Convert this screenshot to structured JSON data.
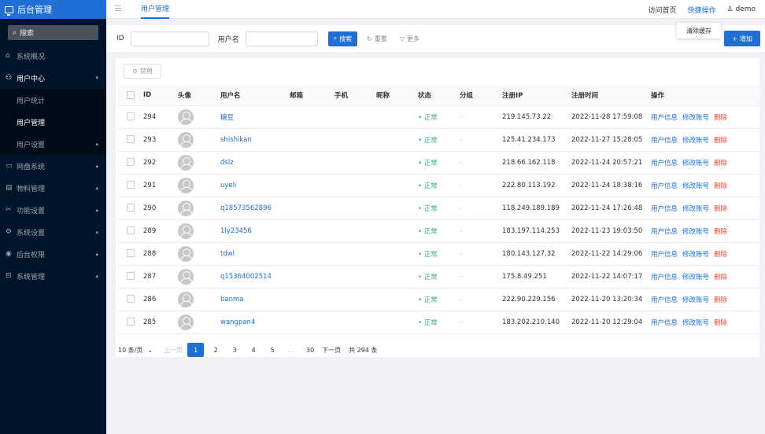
{
  "app": {
    "title": "后台管理"
  },
  "sidebar": {
    "search_label": "搜索",
    "items": [
      {
        "icon": "home-icon",
        "glyph": "⌂",
        "label": "系统概况"
      },
      {
        "icon": "user-group-icon",
        "glyph": "⚇",
        "label": "用户中心"
      },
      {
        "icon": "cloud-disk-icon",
        "glyph": "▭",
        "label": "网盘系统"
      },
      {
        "icon": "materials-icon",
        "glyph": "▤",
        "label": "物料管理"
      },
      {
        "icon": "function-settings-icon",
        "glyph": "✂",
        "label": "功能设置"
      },
      {
        "icon": "system-settings-icon",
        "glyph": "⚙",
        "label": "系统设置"
      },
      {
        "icon": "permissions-icon",
        "glyph": "◉",
        "label": "后台权限"
      },
      {
        "icon": "system-manage-icon",
        "glyph": "⊟",
        "label": "系统管理"
      }
    ],
    "submenu": [
      {
        "label": "用户统计"
      },
      {
        "label": "用户管理"
      },
      {
        "label": "用户设置"
      }
    ]
  },
  "topbar": {
    "tab": "用户管理",
    "visit_home": "访问首页",
    "quick_ops": "快捷操作",
    "user": "demo"
  },
  "dropdown": {
    "clear_cache": "清除缓存"
  },
  "filter": {
    "id_label": "ID",
    "username_label": "用户名",
    "search_btn": "搜索",
    "reset_btn": "重置",
    "more_btn": "更多",
    "add_btn": "增加"
  },
  "table": {
    "disable_btn": "禁用",
    "headers": [
      "ID",
      "头像",
      "用户名",
      "邮箱",
      "手机",
      "昵称",
      "状态",
      "分组",
      "注册IP",
      "注册时间",
      "操作"
    ],
    "rows": [
      {
        "id": "294",
        "username": "糖豆",
        "status": "• 正常",
        "group": "-",
        "ip": "219.145.73.22",
        "time": "2022-11-28 17:59:08"
      },
      {
        "id": "293",
        "username": "shishikan",
        "status": "• 正常",
        "group": "-",
        "ip": "125.41.234.173",
        "time": "2022-11-27 15:28:05"
      },
      {
        "id": "292",
        "username": "dslz",
        "status": "• 正常",
        "group": "-",
        "ip": "218.66.162.118",
        "time": "2022-11-24 20:57:21"
      },
      {
        "id": "291",
        "username": "uyeli",
        "status": "• 正常",
        "group": "-",
        "ip": "222.80.113.192",
        "time": "2022-11-24 18:38:16"
      },
      {
        "id": "290",
        "username": "q18573562896",
        "status": "• 正常",
        "group": "-",
        "ip": "118.249.189.189",
        "time": "2022-11-24 17:26:48"
      },
      {
        "id": "289",
        "username": "1ly23456",
        "status": "• 正常",
        "group": "-",
        "ip": "183.197.114.253",
        "time": "2022-11-23 19:03:50"
      },
      {
        "id": "288",
        "username": "tdwl",
        "status": "• 正常",
        "group": "-",
        "ip": "180.143.127.32",
        "time": "2022-11-22 14:29:06"
      },
      {
        "id": "287",
        "username": "q15364002514",
        "status": "• 正常",
        "group": "-",
        "ip": "175.8.49.251",
        "time": "2022-11-22 14:07:17"
      },
      {
        "id": "286",
        "username": "banma",
        "status": "• 正常",
        "group": "-",
        "ip": "222.90.229.156",
        "time": "2022-11-20 13:20:34"
      },
      {
        "id": "285",
        "username": "wangpan4",
        "status": "• 正常",
        "group": "-",
        "ip": "183.202.210.140",
        "time": "2022-11-20 12:29:04"
      }
    ],
    "ops": {
      "info": "用户信息",
      "edit": "修改账号",
      "delete": "删除"
    }
  },
  "pagination": {
    "page_size": "10 条/页",
    "prev": "上一页",
    "pages": [
      "1",
      "2",
      "3",
      "4",
      "5",
      "...",
      "30"
    ],
    "next": "下一页",
    "total": "共 294 条"
  },
  "colors": {
    "accent": "#1f6fd6",
    "sidebar_bg": "#001529",
    "status_ok": "#36b37e",
    "danger": "#e74c3c"
  }
}
